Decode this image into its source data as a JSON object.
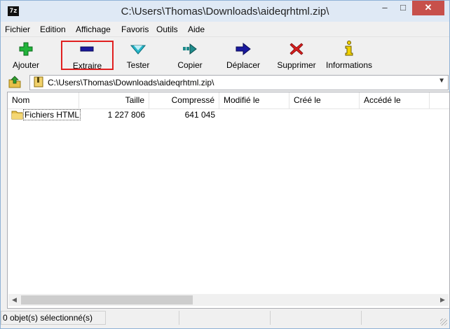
{
  "window": {
    "title": "C:\\Users\\Thomas\\Downloads\\aideqrhtml.zip\\",
    "app_icon_text": "7z",
    "controls": {
      "minimize": "–",
      "maximize": "□",
      "close": "✕"
    }
  },
  "menu": [
    "Fichier",
    "Edition",
    "Affichage",
    "Favoris",
    "Outils",
    "Aide"
  ],
  "toolbar": {
    "buttons": [
      {
        "label": "Ajouter",
        "icon": "plus-icon",
        "color": "#21b33a"
      },
      {
        "label": "Extraire",
        "icon": "minus-icon",
        "color": "#1a1a9e",
        "highlighted": true,
        "highlight_color": "#e02020"
      },
      {
        "label": "Tester",
        "icon": "chevron-down-icon",
        "color": "#26b6c9"
      },
      {
        "label": "Copier",
        "icon": "copy-arrow-icon",
        "color": "#1f8c8c"
      },
      {
        "label": "Déplacer",
        "icon": "arrow-right-icon",
        "color": "#1a1a9e"
      },
      {
        "label": "Supprimer",
        "icon": "x-icon",
        "color": "#d51e1e"
      },
      {
        "label": "Informations",
        "icon": "info-icon",
        "color": "#f1d100"
      }
    ]
  },
  "address": {
    "path": "C:\\Users\\Thomas\\Downloads\\aideqrhtml.zip\\"
  },
  "columns": [
    "Nom",
    "Taille",
    "Compressé",
    "Modifié le",
    "Créé le",
    "Accédé le"
  ],
  "rows": [
    {
      "name": "Fichiers HTML",
      "size": "1 227 806",
      "compressed": "641 045",
      "modified": "",
      "created": "",
      "accessed": ""
    }
  ],
  "status": {
    "selection": "0 objet(s) sélectionné(s)"
  }
}
